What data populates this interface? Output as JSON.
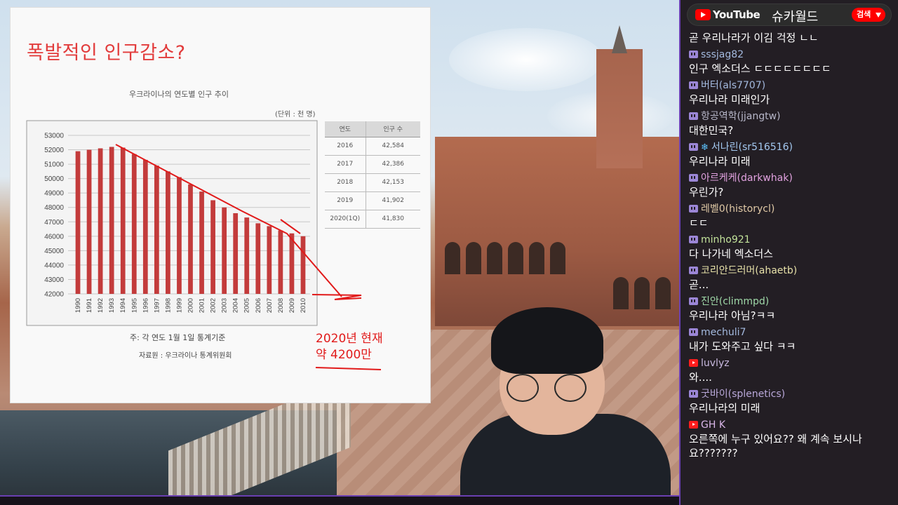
{
  "slide": {
    "title": "폭발적인 인구감소?",
    "chart_title": "우크라이나의 연도별 인구 추이",
    "unit": "(단위 : 천 명)",
    "note": "주: 각 연도 1월 1일 통계기준",
    "source": "자료원 : 우크라이나 통계위원회",
    "annotation_line1": "2020년 현재",
    "annotation_line2": "약 4200만",
    "table": {
      "headers": [
        "연도",
        "인구 수"
      ],
      "rows": [
        [
          "2016",
          "42,584"
        ],
        [
          "2017",
          "42,386"
        ],
        [
          "2018",
          "42,153"
        ],
        [
          "2019",
          "41,902"
        ],
        [
          "2020(1Q)",
          "41,830"
        ]
      ]
    }
  },
  "chart_data": {
    "type": "bar",
    "categories": [
      "1990",
      "1991",
      "1992",
      "1993",
      "1994",
      "1995",
      "1996",
      "1997",
      "1998",
      "1999",
      "2000",
      "2001",
      "2002",
      "2003",
      "2004",
      "2005",
      "2006",
      "2007",
      "2008",
      "2009",
      "2010"
    ],
    "values": [
      51900,
      52000,
      52100,
      52200,
      52150,
      51700,
      51300,
      50900,
      50500,
      50100,
      49600,
      49100,
      48500,
      48000,
      47600,
      47300,
      46900,
      46700,
      46400,
      46200,
      46000
    ],
    "yticks": [
      42000,
      43000,
      44000,
      45000,
      46000,
      47000,
      48000,
      49000,
      50000,
      51000,
      52000,
      53000
    ],
    "ylim": [
      42000,
      53000
    ],
    "bar_color": "#c33b3b",
    "trend_color": "#e11a1a"
  },
  "chat": {
    "platform": "YouTube",
    "channel": "슈카월드",
    "search_label": "검색",
    "messages": [
      {
        "author": "",
        "badge": "",
        "text": "곧 우리나라가 이김 걱정 ㄴㄴ",
        "color": "#ffffff"
      },
      {
        "author": "sssjag82",
        "badge": "twitch",
        "text": "인구 엑소더스 ㄷㄷㄷㄷㄷㄷㄷㄷ",
        "color": "#a3b9de"
      },
      {
        "author": "버터(als7707)",
        "badge": "twitch",
        "text": "우리나라 미래인가",
        "color": "#a3b9de"
      },
      {
        "author": "항공역학(jjangtw)",
        "badge": "twitch",
        "text": "대한민국?",
        "color": "#b7b7c9"
      },
      {
        "author": "서나린(sr516516)",
        "badge": "twitch",
        "snow": true,
        "text": "우리나라 미래",
        "color": "#a3c8f0"
      },
      {
        "author": "아르케케(darkwhak)",
        "badge": "twitch",
        "text": "우린가?",
        "color": "#e2a2e0"
      },
      {
        "author": "레벨0(historycl)",
        "badge": "twitch",
        "text": "ㄷㄷ",
        "color": "#e0c9a6"
      },
      {
        "author": "minho921",
        "badge": "twitch",
        "text": "다 나가네 엑소더스",
        "color": "#c2e29a"
      },
      {
        "author": "코리안드러머(ahaetb)",
        "badge": "twitch",
        "text": "곧...",
        "color": "#e6e0a8"
      },
      {
        "author": "진안(climmpd)",
        "badge": "twitch",
        "text": "우리나라 아님?ㅋㅋ",
        "color": "#9fd8a8"
      },
      {
        "author": "mechuli7",
        "badge": "twitch",
        "text": "내가 도와주고 싶다 ㅋㅋ",
        "color": "#a3b9de"
      },
      {
        "author": "luvlyz",
        "badge": "youtube",
        "text": "와....",
        "color": "#c8b8de"
      },
      {
        "author": "굿바이(splenetics)",
        "badge": "twitch",
        "text": "우리나라의 미래",
        "color": "#b9a8d9"
      },
      {
        "author": "GH K",
        "badge": "youtube",
        "text": "오른쪽에 누구 있어요?? 왜 계속 보시나 요???????",
        "color": "#d9b6e8"
      }
    ]
  }
}
